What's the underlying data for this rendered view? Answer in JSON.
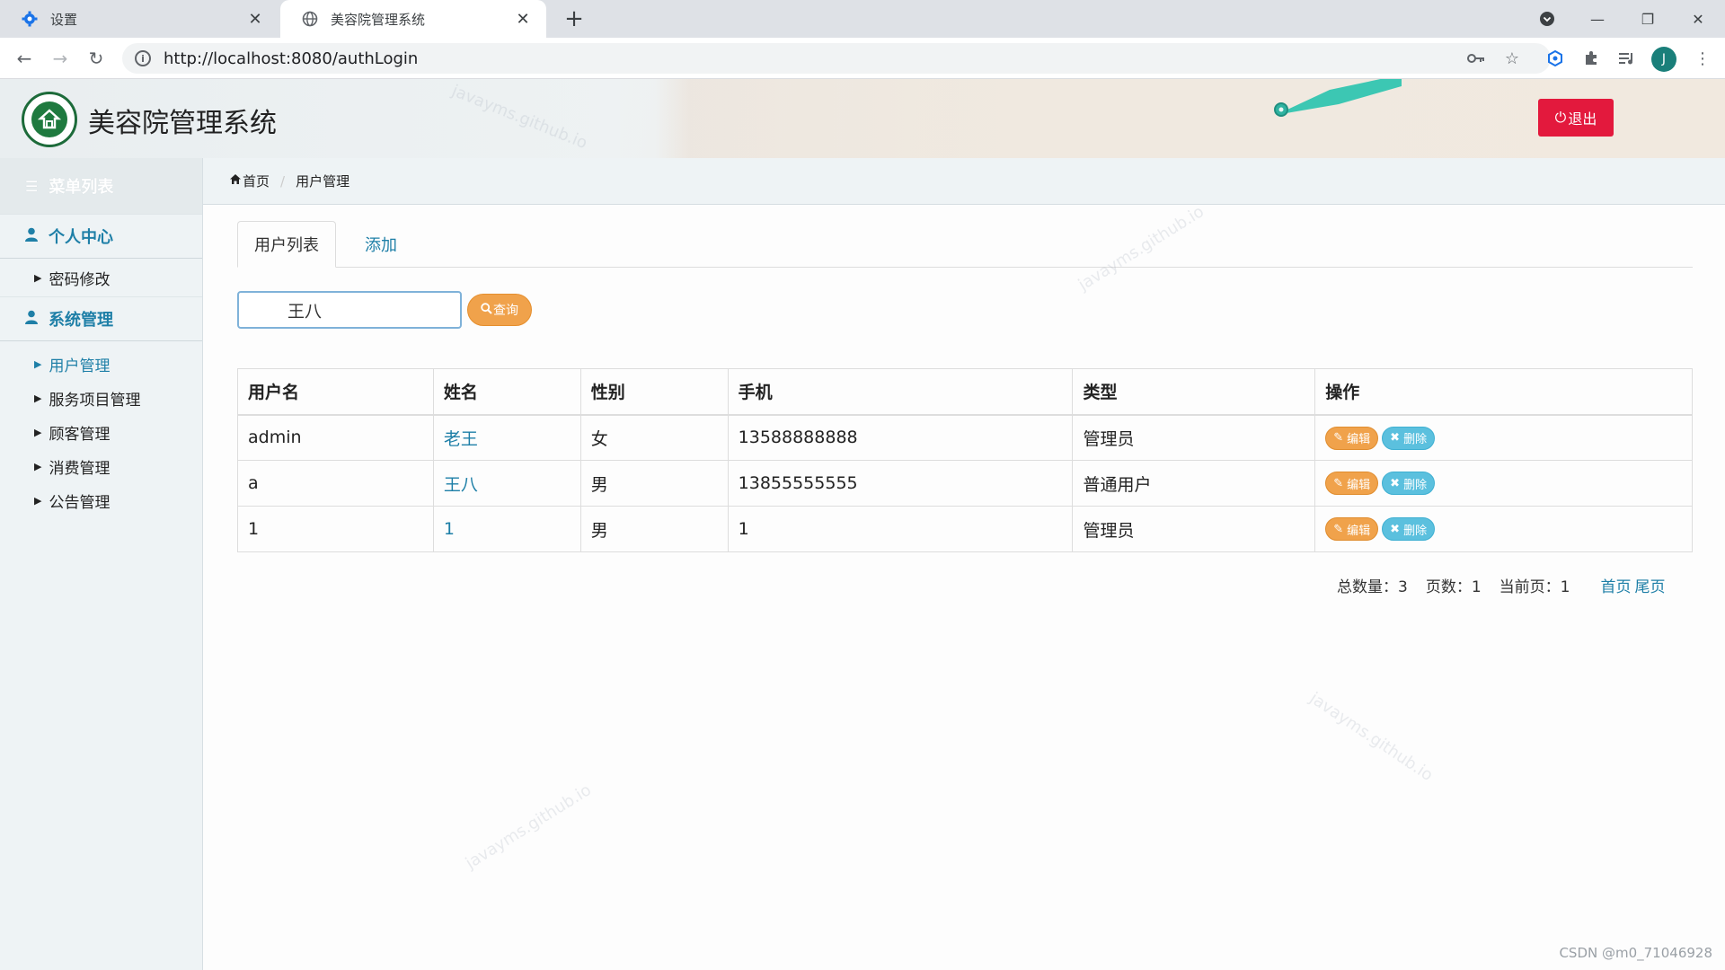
{
  "browser": {
    "tabs": [
      {
        "title": "设置",
        "icon": "gear-icon"
      },
      {
        "title": "美容院管理系统",
        "icon": "globe-icon"
      }
    ],
    "url": "http://localhost:8080/authLogin",
    "profile_initial": "J"
  },
  "app": {
    "title": "美容院管理系统",
    "logout_label": "退出"
  },
  "sidebar": {
    "header": "菜单列表",
    "groups": [
      {
        "label": "个人中心",
        "items": [
          {
            "label": "密码修改"
          }
        ]
      },
      {
        "label": "系统管理",
        "items": [
          {
            "label": "用户管理"
          },
          {
            "label": "服务项目管理"
          },
          {
            "label": "顾客管理"
          },
          {
            "label": "消费管理"
          },
          {
            "label": "公告管理"
          }
        ]
      }
    ]
  },
  "breadcrumb": {
    "home": "首页",
    "current": "用户管理"
  },
  "content_tabs": [
    {
      "label": "用户列表"
    },
    {
      "label": "添加"
    }
  ],
  "search": {
    "value": "王八",
    "button_label": "查询"
  },
  "table": {
    "headers": [
      "用户名",
      "姓名",
      "性别",
      "手机",
      "类型",
      "操作"
    ],
    "rows": [
      {
        "username": "admin",
        "name": "老王",
        "gender": "女",
        "phone": "13588888888",
        "type": "管理员"
      },
      {
        "username": "a",
        "name": "王八",
        "gender": "男",
        "phone": "13855555555",
        "type": "普通用户"
      },
      {
        "username": "1",
        "name": "1",
        "gender": "男",
        "phone": "1",
        "type": "管理员"
      }
    ],
    "edit_label": "编辑",
    "delete_label": "删除"
  },
  "pager": {
    "total": "总数量：3",
    "pages": "页数：1",
    "current": "当前页：1",
    "first": "首页",
    "last": "尾页"
  },
  "watermark": "javayms.github.io",
  "footer_credit": "CSDN @m0_71046928",
  "colors": {
    "accent": "#1e7fa7",
    "logout": "#e3193d",
    "search_button": "#f0a24b",
    "delete_button": "#5bc0de"
  }
}
